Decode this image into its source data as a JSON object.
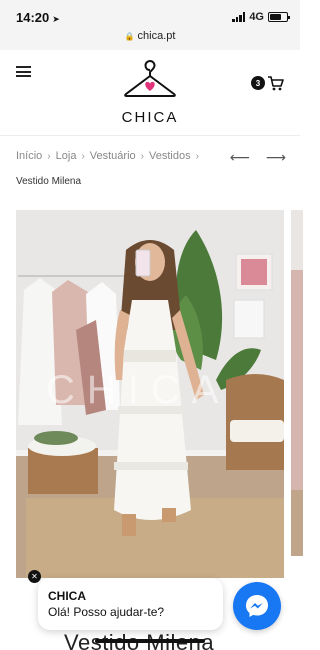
{
  "status_bar": {
    "time": "14:20",
    "network": "4G"
  },
  "browser": {
    "url": "chica.pt"
  },
  "header": {
    "logo_text": "CHICA",
    "cart_count": "3"
  },
  "breadcrumb": {
    "items": [
      "Início",
      "Loja",
      "Vestuário",
      "Vestidos"
    ],
    "separator": "›",
    "prev_arrow": "⟵",
    "next_arrow": "⟶",
    "current": "Vestido Milena"
  },
  "product": {
    "image_watermark": "CHICA",
    "title": "Vestido Milena"
  },
  "chat": {
    "name": "CHICA",
    "message": "Olá! Posso ajudar-te?"
  },
  "colors": {
    "accent_pink": "#e0337a",
    "messenger_blue": "#1877f2"
  }
}
